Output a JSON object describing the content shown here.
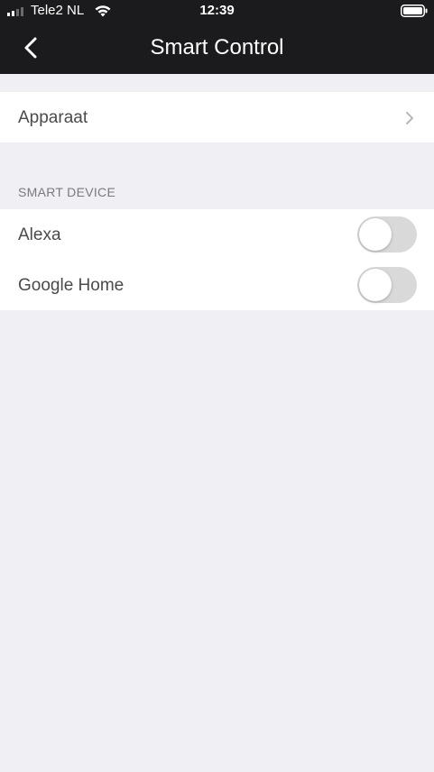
{
  "status_bar": {
    "carrier": "Tele2 NL",
    "time": "12:39",
    "signal_icon": "signal-bars-icon",
    "wifi_icon": "wifi-icon",
    "battery_icon": "battery-icon"
  },
  "nav": {
    "title": "Smart Control",
    "back_icon": "chevron-left-icon"
  },
  "device_row": {
    "label": "Apparaat",
    "icon": "chevron-right-icon"
  },
  "smart_device": {
    "header": "SMART DEVICE",
    "items": [
      {
        "label": "Alexa",
        "enabled": false
      },
      {
        "label": "Google Home",
        "enabled": false
      }
    ]
  },
  "colors": {
    "nav_background": "#1b1b1d",
    "page_background": "#efeff4",
    "toggle_off": "#d9d9d9",
    "text": "#4a4a4a",
    "section_header": "#7a7a7e"
  }
}
